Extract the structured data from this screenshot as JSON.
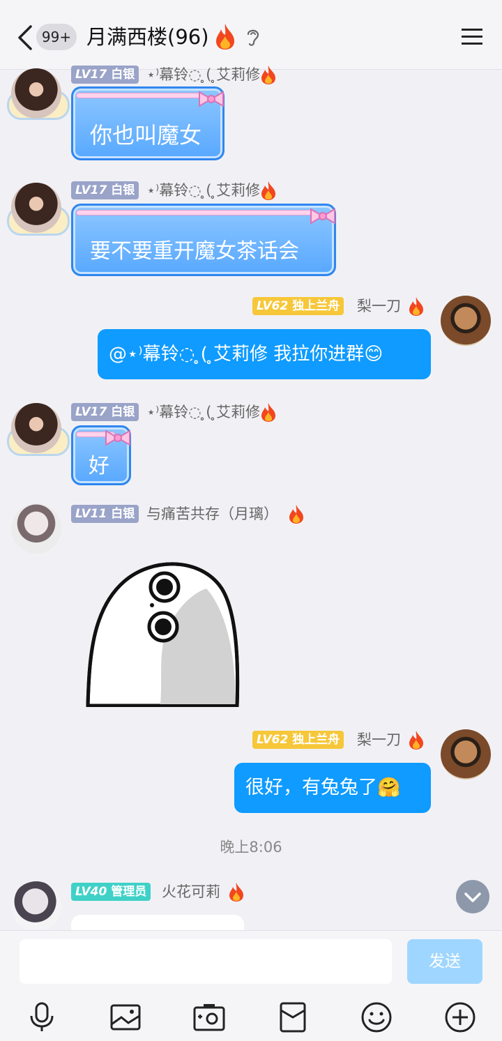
{
  "header": {
    "unread_badge": "99+",
    "title": "月满西楼(96)"
  },
  "messages": [
    {
      "level": "LV17",
      "rank": "白银",
      "nick": "⋆⁾幕铃◌ ̥( ̥艾莉修",
      "text": "你也叫魔女"
    },
    {
      "level": "LV17",
      "rank": "白银",
      "nick": "⋆⁾幕铃◌ ̥( ̥艾莉修",
      "text": "要不要重开魔女茶话会"
    },
    {
      "level": "LV62",
      "rank": "独上兰舟",
      "nick": "梨一刀",
      "text": "@⋆⁾幕铃◌ ̥( ̥艾莉修 我拉你进群😊"
    },
    {
      "level": "LV17",
      "rank": "白银",
      "nick": "⋆⁾幕铃◌ ̥( ̥艾莉修",
      "text": "好"
    },
    {
      "level": "LV11",
      "rank": "白银",
      "nick": "与痛苦共存（月璃）",
      "text": ""
    },
    {
      "level": "LV62",
      "rank": "独上兰舟",
      "nick": "梨一刀",
      "text": "很好，有兔兔了🤗"
    },
    {
      "level": "LV40",
      "rank": "管理员",
      "nick": "火花可莉",
      "text": ""
    }
  ],
  "timestamp": "晚上8:06",
  "input": {
    "placeholder": "",
    "send_label": "发送"
  },
  "toolbar": [
    "microphone-icon",
    "image-icon",
    "camera-icon",
    "red-packet-icon",
    "emoji-icon",
    "plus-icon"
  ],
  "colors": {
    "accent_blue": "#0f9bff",
    "send_disabled": "#9fd6ff",
    "background": "#f1f1f5"
  }
}
